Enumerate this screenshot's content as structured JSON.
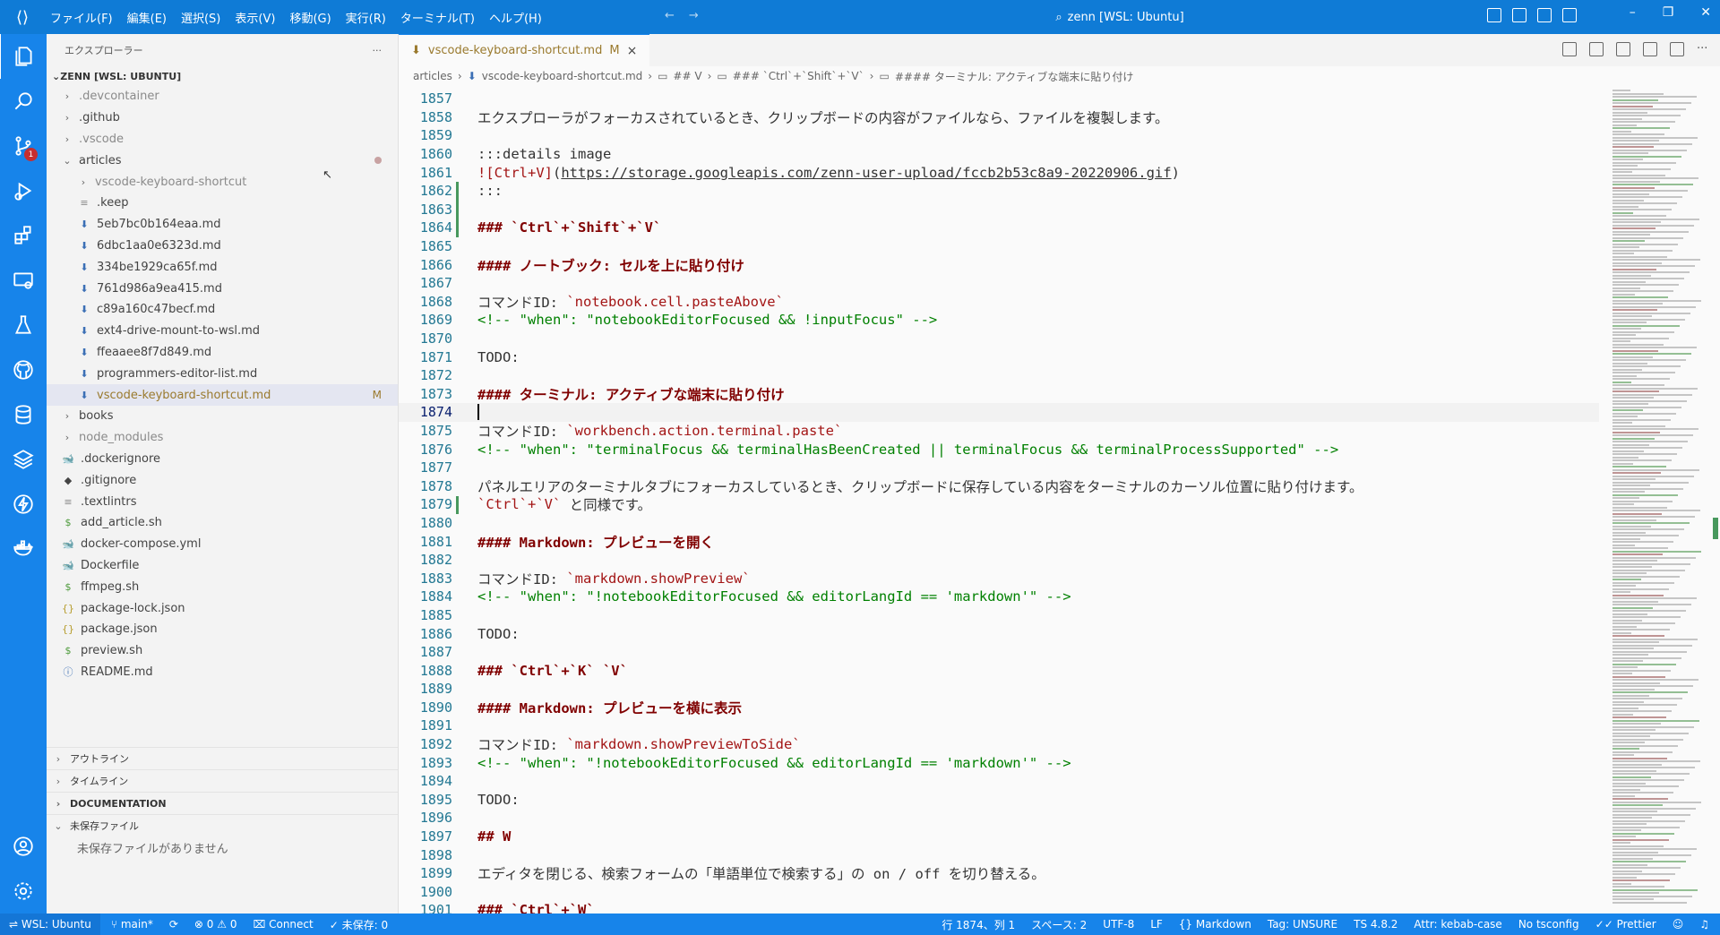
{
  "titlebar": {
    "menu": [
      "ファイル(F)",
      "編集(E)",
      "選択(S)",
      "表示(V)",
      "移動(G)",
      "実行(R)",
      "ターミナル(T)",
      "ヘルプ(H)"
    ],
    "search_text": "zenn [WSL: Ubuntu]",
    "search_icon": "search-icon",
    "accent": "#0f7bd6"
  },
  "activitybar": {
    "scm_badge": "1",
    "icons": [
      "explorer-icon",
      "search-icon",
      "source-control-icon",
      "run-debug-icon",
      "extensions-icon",
      "remote-explorer-icon",
      "testing-icon",
      "github-icon",
      "database-icon",
      "layers-icon",
      "lightning-icon",
      "docker-icon"
    ],
    "bottom_icons": [
      "account-icon",
      "settings-gear-icon"
    ],
    "color": "#1784ea"
  },
  "sidebar": {
    "title": "エクスプローラー",
    "more": "···",
    "root": "ZENN [WSL: UBUNTU]",
    "tree": [
      {
        "name": ".devcontainer",
        "type": "folder",
        "indent": 1,
        "dim": true
      },
      {
        "name": ".github",
        "type": "folder",
        "indent": 1
      },
      {
        "name": ".vscode",
        "type": "folder",
        "indent": 1,
        "dim": true
      },
      {
        "name": "articles",
        "type": "folder-open",
        "indent": 1,
        "dot": true
      },
      {
        "name": "vscode-keyboard-shortcut",
        "type": "folder",
        "indent": 2,
        "dim": true
      },
      {
        "name": ".keep",
        "type": "file",
        "indent": 2
      },
      {
        "name": "5eb7bc0b164eaa.md",
        "type": "md",
        "indent": 2
      },
      {
        "name": "6dbc1aa0e6323d.md",
        "type": "md",
        "indent": 2
      },
      {
        "name": "334be1929ca65f.md",
        "type": "md",
        "indent": 2
      },
      {
        "name": "761d986a9ea415.md",
        "type": "md",
        "indent": 2
      },
      {
        "name": "c89a160c47becf.md",
        "type": "md",
        "indent": 2
      },
      {
        "name": "ext4-drive-mount-to-wsl.md",
        "type": "md",
        "indent": 2
      },
      {
        "name": "ffeaaee8f7d849.md",
        "type": "md",
        "indent": 2
      },
      {
        "name": "programmers-editor-list.md",
        "type": "md",
        "indent": 2
      },
      {
        "name": "vscode-keyboard-shortcut.md",
        "type": "md",
        "indent": 2,
        "selected": true,
        "modified": "M"
      },
      {
        "name": "books",
        "type": "folder",
        "indent": 1
      },
      {
        "name": "node_modules",
        "type": "folder",
        "indent": 1,
        "dim": true
      },
      {
        "name": ".dockerignore",
        "type": "docker",
        "indent": 1
      },
      {
        "name": ".gitignore",
        "type": "git",
        "indent": 1
      },
      {
        "name": ".textlintrs",
        "type": "file",
        "indent": 1
      },
      {
        "name": "add_article.sh",
        "type": "sh",
        "indent": 1
      },
      {
        "name": "docker-compose.yml",
        "type": "docker",
        "indent": 1
      },
      {
        "name": "Dockerfile",
        "type": "docker",
        "indent": 1
      },
      {
        "name": "ffmpeg.sh",
        "type": "sh",
        "indent": 1
      },
      {
        "name": "package-lock.json",
        "type": "json",
        "indent": 1
      },
      {
        "name": "package.json",
        "type": "json",
        "indent": 1
      },
      {
        "name": "preview.sh",
        "type": "sh",
        "indent": 1
      },
      {
        "name": "README.md",
        "type": "info",
        "indent": 1
      }
    ],
    "panels": [
      {
        "label": "アウトライン",
        "bold": false,
        "open": false
      },
      {
        "label": "タイムライン",
        "bold": false,
        "open": false
      },
      {
        "label": "DOCUMENTATION",
        "bold": true,
        "open": false
      },
      {
        "label": "未保存ファイル",
        "bold": false,
        "open": true
      }
    ],
    "unsaved_empty": "未保存ファイルがありません"
  },
  "editor": {
    "tab": {
      "label": "vscode-keyboard-shortcut.md",
      "modified": "M",
      "close": "×"
    },
    "breadcrumb": [
      "articles",
      "vscode-keyboard-shortcut.md",
      "## V",
      "### `Ctrl`+`Shift`+`V`",
      "#### ターミナル: アクティブな端末に貼り付け"
    ],
    "current_line": 1874,
    "lines": [
      {
        "n": "1857",
        "segs": []
      },
      {
        "n": "1858",
        "segs": [
          {
            "t": "エクスプローラがフォーカスされているとき、クリップボードの内容がファイルなら、ファイルを複製します。",
            "c": "lt"
          }
        ]
      },
      {
        "n": "1859",
        "segs": []
      },
      {
        "n": "1860",
        "segs": [
          {
            "t": ":::details image",
            "c": "lt"
          }
        ]
      },
      {
        "n": "1861",
        "segs": [
          {
            "t": "![Ctrl+V]",
            "c": "link"
          },
          {
            "t": "(",
            "c": "lt"
          },
          {
            "t": "https://storage.googleapis.com/zenn-user-upload/fccb2b53c8a9-20220906.gif",
            "c": "url"
          },
          {
            "t": ")",
            "c": "lt"
          }
        ]
      },
      {
        "n": "1862",
        "segs": [
          {
            "t": ":::",
            "c": "lt"
          }
        ]
      },
      {
        "n": "1863",
        "segs": []
      },
      {
        "n": "1864",
        "segs": [
          {
            "t": "### `Ctrl`+`Shift`+`V`",
            "c": "h"
          }
        ]
      },
      {
        "n": "1865",
        "segs": []
      },
      {
        "n": "1866",
        "segs": [
          {
            "t": "#### ノートブック: セルを上に貼り付け",
            "c": "h"
          }
        ]
      },
      {
        "n": "1867",
        "segs": []
      },
      {
        "n": "1868",
        "segs": [
          {
            "t": "コマンドID: ",
            "c": "lt"
          },
          {
            "t": "`notebook.cell.pasteAbove`",
            "c": "ic"
          }
        ]
      },
      {
        "n": "1869",
        "segs": [
          {
            "t": "<!-- \"when\": \"notebookEditorFocused && !inputFocus\" -->",
            "c": "cm"
          }
        ]
      },
      {
        "n": "1870",
        "segs": []
      },
      {
        "n": "1871",
        "segs": [
          {
            "t": "TODO:",
            "c": "lt"
          }
        ]
      },
      {
        "n": "1872",
        "segs": []
      },
      {
        "n": "1873",
        "segs": [
          {
            "t": "#### ターミナル: アクティブな端末に貼り付け",
            "c": "h"
          }
        ]
      },
      {
        "n": "1874",
        "segs": []
      },
      {
        "n": "1875",
        "segs": [
          {
            "t": "コマンドID: ",
            "c": "lt"
          },
          {
            "t": "`workbench.action.terminal.paste`",
            "c": "ic"
          }
        ]
      },
      {
        "n": "1876",
        "segs": [
          {
            "t": "<!-- \"when\": \"terminalFocus && terminalHasBeenCreated || terminalFocus && terminalProcessSupported\" -->",
            "c": "cm"
          }
        ]
      },
      {
        "n": "1877",
        "segs": []
      },
      {
        "n": "1878",
        "segs": [
          {
            "t": "パネルエリアのターミナルタブにフォーカスしているとき、クリップボードに保存している内容をターミナルのカーソル位置に貼り付けます。",
            "c": "lt"
          }
        ]
      },
      {
        "n": "1879",
        "segs": [
          {
            "t": "`Ctrl`+`V`",
            "c": "ic"
          },
          {
            "t": " と同様です。",
            "c": "lt"
          }
        ]
      },
      {
        "n": "1880",
        "segs": []
      },
      {
        "n": "1881",
        "segs": [
          {
            "t": "#### Markdown: プレビューを開く",
            "c": "h"
          }
        ]
      },
      {
        "n": "1882",
        "segs": []
      },
      {
        "n": "1883",
        "segs": [
          {
            "t": "コマンドID: ",
            "c": "lt"
          },
          {
            "t": "`markdown.showPreview`",
            "c": "ic"
          }
        ]
      },
      {
        "n": "1884",
        "segs": [
          {
            "t": "<!-- \"when\": \"!notebookEditorFocused && editorLangId == 'markdown'\" -->",
            "c": "cm"
          }
        ]
      },
      {
        "n": "1885",
        "segs": []
      },
      {
        "n": "1886",
        "segs": [
          {
            "t": "TODO:",
            "c": "lt"
          }
        ]
      },
      {
        "n": "1887",
        "segs": []
      },
      {
        "n": "1888",
        "segs": [
          {
            "t": "### `Ctrl`+`K` `V`",
            "c": "h"
          }
        ]
      },
      {
        "n": "1889",
        "segs": []
      },
      {
        "n": "1890",
        "segs": [
          {
            "t": "#### Markdown: プレビューを横に表示",
            "c": "h"
          }
        ]
      },
      {
        "n": "1891",
        "segs": []
      },
      {
        "n": "1892",
        "segs": [
          {
            "t": "コマンドID: ",
            "c": "lt"
          },
          {
            "t": "`markdown.showPreviewToSide`",
            "c": "ic"
          }
        ]
      },
      {
        "n": "1893",
        "segs": [
          {
            "t": "<!-- \"when\": \"!notebookEditorFocused && editorLangId == 'markdown'\" -->",
            "c": "cm"
          }
        ]
      },
      {
        "n": "1894",
        "segs": []
      },
      {
        "n": "1895",
        "segs": [
          {
            "t": "TODO:",
            "c": "lt"
          }
        ]
      },
      {
        "n": "1896",
        "segs": []
      },
      {
        "n": "1897",
        "segs": [
          {
            "t": "## W",
            "c": "h"
          }
        ]
      },
      {
        "n": "1898",
        "segs": []
      },
      {
        "n": "1899",
        "segs": [
          {
            "t": "エディタを閉じる、検索フォームの「単語単位で検索する」の on / off を切り替える。",
            "c": "lt"
          }
        ]
      },
      {
        "n": "1900",
        "segs": []
      },
      {
        "n": "1901",
        "segs": [
          {
            "t": "### `Ctrl`+`W`",
            "c": "h"
          }
        ]
      }
    ]
  },
  "statusbar": {
    "remote": "WSL: Ubuntu",
    "branch": "main*",
    "errors": "0",
    "warnings": "0",
    "connect": "Connect",
    "unsaved": "未保存: 0",
    "position": "行 1874、列 1",
    "spaces": "スペース: 2",
    "encoding": "UTF-8",
    "eol": "LF",
    "language": "Markdown",
    "tag": "Tag: UNSURE",
    "ts": "TS 4.8.2",
    "attr": "Attr: kebab-case",
    "tsconfig": "No tsconfig",
    "prettier": "Prettier"
  }
}
